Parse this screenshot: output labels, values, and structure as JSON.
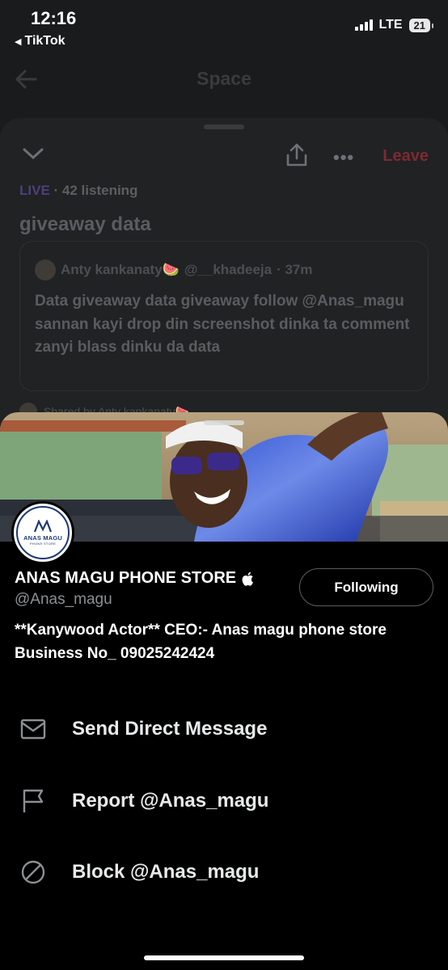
{
  "status_bar": {
    "time": "12:16",
    "back_app": "TikTok",
    "network": "LTE",
    "battery": "21"
  },
  "background": {
    "nav_title": "Space",
    "leave_label": "Leave",
    "live_label": "LIVE",
    "listening": "· 42 listening",
    "space_title": "giveaway data",
    "tweet": {
      "author": "Anty kankanaty🍉",
      "handle": "@__khadeeja",
      "time": "· 37m",
      "body": "Data giveaway data giveaway follow @Anas_magu  sannan kayi drop din screenshot dinka ta comment zanyi blass dinku da data"
    },
    "shared_by": "Shared by Anty kankanaty🍉"
  },
  "profile": {
    "logo_text": "ANAS MAGU",
    "logo_sub": "PHONE STORE",
    "name": "ANAS MAGU PHONE STORE",
    "handle": "@Anas_magu",
    "follow_label": "Following",
    "bio": "**Kanywood Actor** CEO:- Anas magu phone store  Business No_ 09025242424"
  },
  "menu": {
    "items": [
      {
        "label": "Send Direct Message",
        "icon": "envelope-icon"
      },
      {
        "label": "Report @Anas_magu",
        "icon": "flag-icon"
      },
      {
        "label": "Block @Anas_magu",
        "icon": "block-icon"
      }
    ]
  },
  "colors": {
    "accent_leave": "#7d2a2f",
    "live": "#4d3f7a",
    "text_secondary": "#8b8f93"
  }
}
